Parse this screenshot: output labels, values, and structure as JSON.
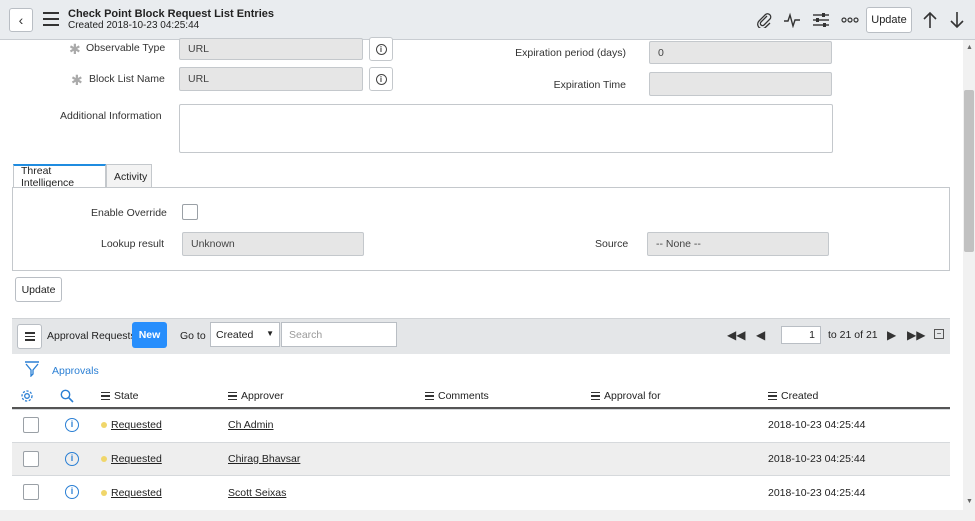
{
  "header": {
    "title": "Check Point Block Request List Entries",
    "subtitle": "Created 2018-10-23 04:25:44",
    "update_label": "Update"
  },
  "form": {
    "observable_type_label": "Observable Type",
    "observable_type_value": "URL",
    "block_list_name_label": "Block List Name",
    "block_list_name_value": "URL",
    "expiration_period_label": "Expiration period (days)",
    "expiration_period_value": "0",
    "expiration_time_label": "Expiration Time",
    "expiration_time_value": "",
    "additional_info_label": "Additional Information",
    "additional_info_value": ""
  },
  "tabs": [
    "Threat Intelligence",
    "Activity"
  ],
  "threat": {
    "enable_override_label": "Enable Override",
    "lookup_result_label": "Lookup result",
    "lookup_result_value": "Unknown",
    "source_label": "Source",
    "source_value": "-- None --"
  },
  "update_button": "Update",
  "related_list": {
    "title": "Approval Requests",
    "new_label": "New",
    "goto_label": "Go to",
    "goto_selected": "Created",
    "search_placeholder": "Search",
    "page_value": "1",
    "page_of": "to 21 of 21",
    "filter_label": "Approvals",
    "columns": [
      "State",
      "Approver",
      "Comments",
      "Approval for",
      "Created"
    ],
    "rows": [
      {
        "state": "Requested",
        "approver": "Ch Admin",
        "comments": "",
        "approval_for": "",
        "created": "2018-10-23 04:25:44"
      },
      {
        "state": "Requested",
        "approver": "Chirag Bhavsar",
        "comments": "",
        "approval_for": "",
        "created": "2018-10-23 04:25:44"
      },
      {
        "state": "Requested",
        "approver": "Scott Seixas",
        "comments": "",
        "approval_for": "",
        "created": "2018-10-23 04:25:44"
      }
    ]
  },
  "colors": {
    "accent": "#278efc",
    "header_bg": "#e9ecef",
    "state_dot": "#f0d66a",
    "tab_active": "#1f8ce0"
  },
  "icons": [
    "back-icon",
    "menu-icon",
    "paperclip-icon",
    "activity-icon",
    "settings-sliders-icon",
    "more-icon",
    "arrow-up-icon",
    "arrow-down-icon",
    "info-icon",
    "filter-icon",
    "gear-icon",
    "search-icon"
  ]
}
